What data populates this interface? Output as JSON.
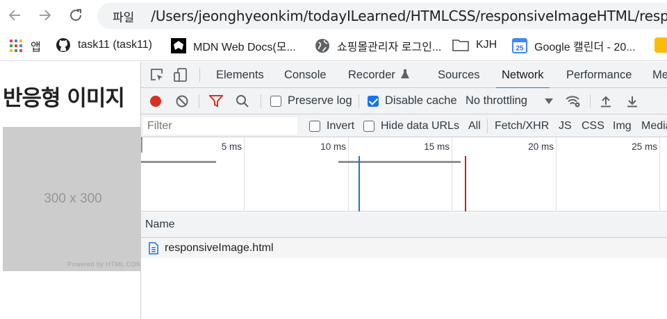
{
  "browser": {
    "omnibox": {
      "scheme_label": "파일",
      "url": "/Users/jeonghyeonkim/todayILearned/HTMLCSS/responsiveImageHTML/responsiveImage.html"
    },
    "bookmarks": [
      {
        "label": "앱",
        "icon": "apps-grid-icon"
      },
      {
        "label": "task11 (task11)",
        "icon": "github-icon"
      },
      {
        "label": "MDN Web Docs(모...",
        "icon": "mdn-icon"
      },
      {
        "label": "쇼핑몰관리자 로그인...",
        "icon": "globe-icon"
      },
      {
        "label": "KJH",
        "icon": "folder-icon"
      },
      {
        "label": "Google 캘린더 - 20...",
        "icon": "google-calendar-icon",
        "badge": "25"
      }
    ]
  },
  "page": {
    "title": "반응형 이미지",
    "placeholder_text": "300 x 300",
    "placeholder_credit": "Powered by HTML.COM"
  },
  "devtools": {
    "tabs": [
      "Elements",
      "Console",
      "Recorder",
      "Sources",
      "Network",
      "Performance",
      "Memory"
    ],
    "active_tab": "Network",
    "toolbar": {
      "preserve_log_label": "Preserve log",
      "preserve_log_checked": false,
      "disable_cache_label": "Disable cache",
      "disable_cache_checked": true,
      "throttling_value": "No throttling"
    },
    "filter": {
      "placeholder": "Filter",
      "invert_label": "Invert",
      "hide_data_urls_label": "Hide data URLs",
      "types": [
        "All",
        "Fetch/XHR",
        "JS",
        "CSS",
        "Img",
        "Media"
      ]
    },
    "timeline": {
      "ticks": [
        "5 ms",
        "10 ms",
        "15 ms",
        "20 ms",
        "25 ms"
      ],
      "dom_content_loaded_color": "#1a73e8",
      "load_color": "#c5221f"
    },
    "requests": {
      "column_name": "Name",
      "rows": [
        {
          "name": "responsiveImage.html",
          "icon": "document-icon"
        }
      ]
    }
  }
}
